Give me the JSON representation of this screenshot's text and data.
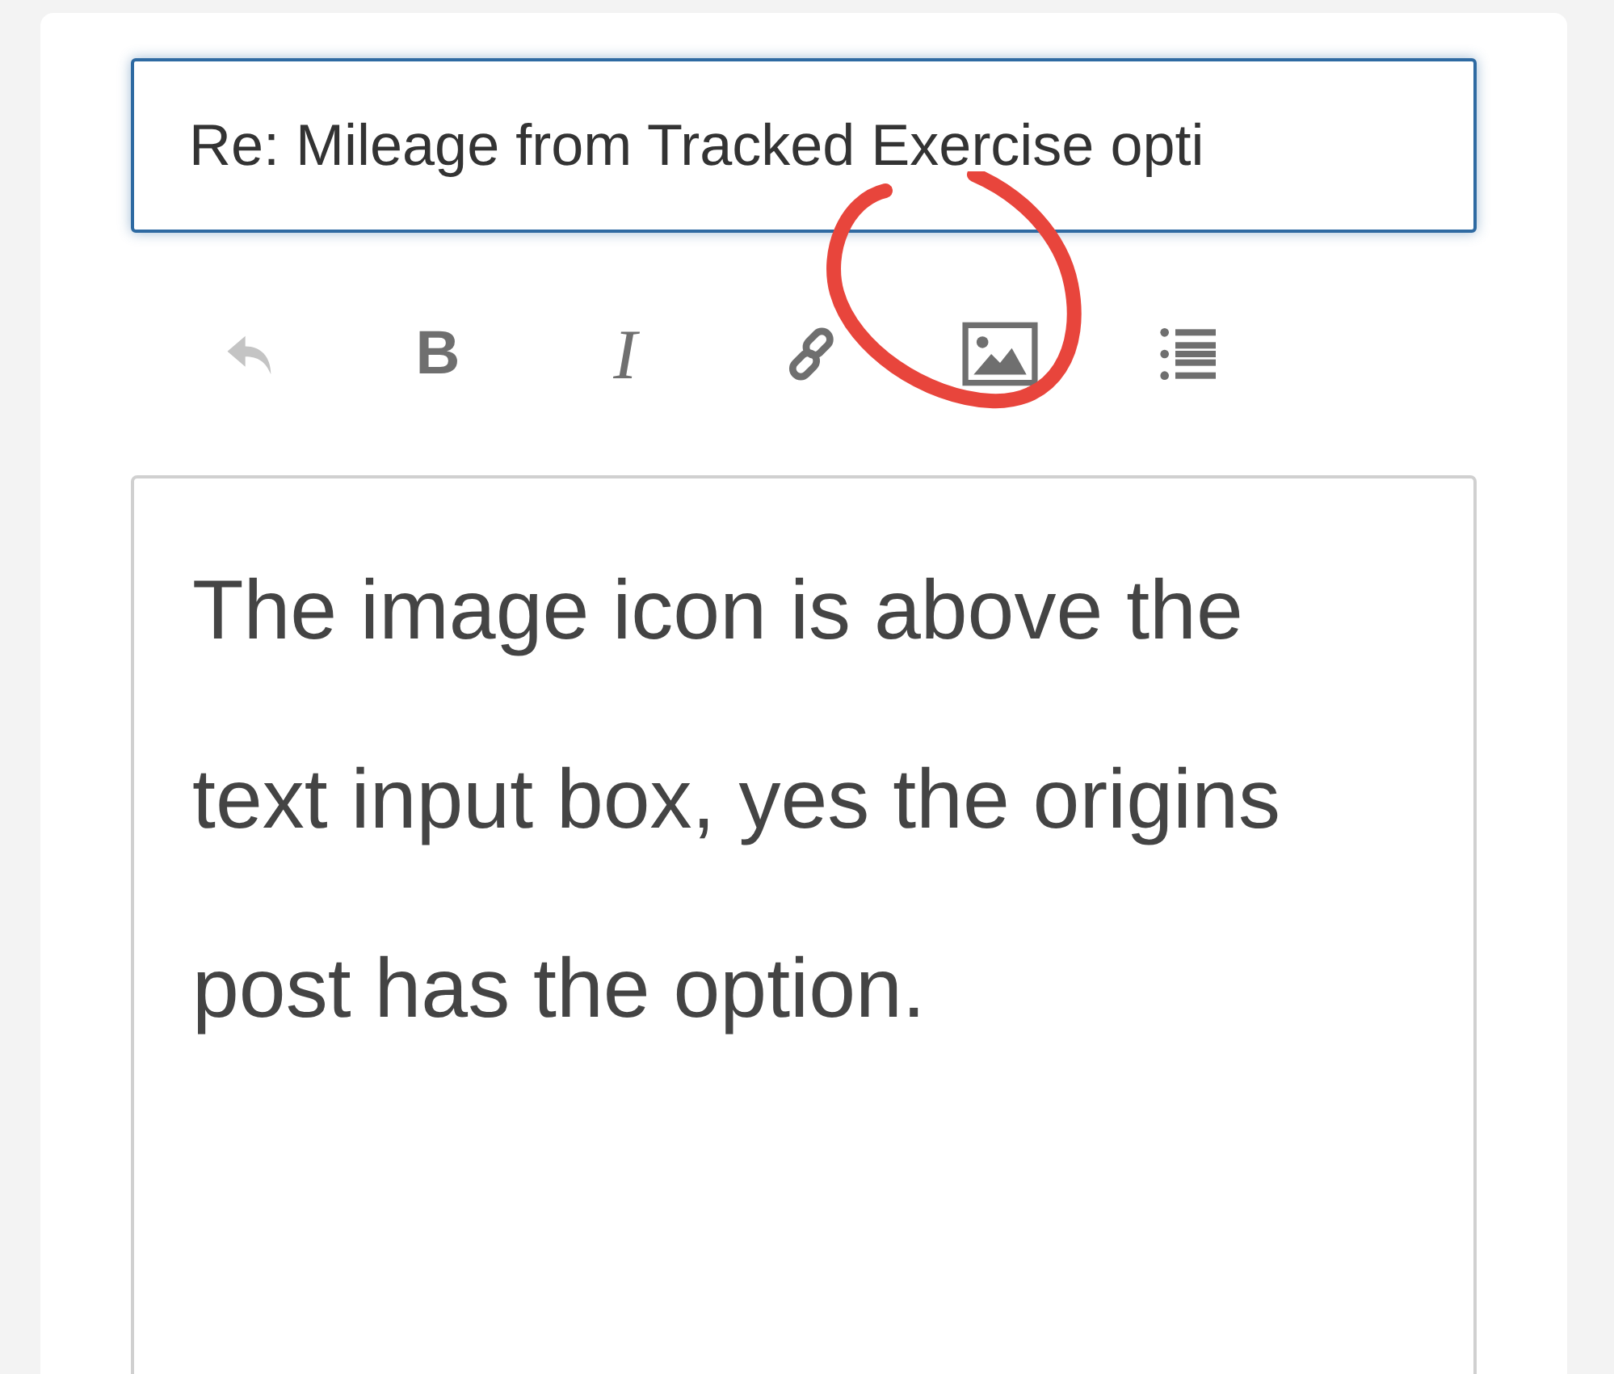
{
  "subject": {
    "value": "Re: Mileage from Tracked Exercise opti"
  },
  "toolbar": [
    {
      "kind": "undo",
      "disabled": true
    },
    {
      "kind": "bold",
      "label": "B",
      "disabled": false
    },
    {
      "kind": "italic",
      "label": "I",
      "disabled": false
    },
    {
      "kind": "link",
      "disabled": false
    },
    {
      "kind": "image",
      "disabled": false
    },
    {
      "kind": "list",
      "disabled": false
    }
  ],
  "body": {
    "value": "The image icon is above the text input box, yes the origins post has the option."
  }
}
